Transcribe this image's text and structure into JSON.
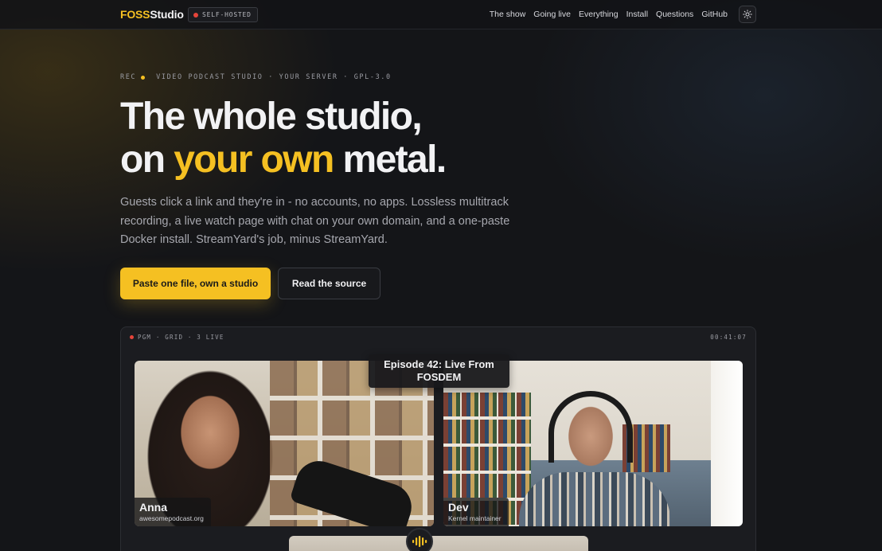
{
  "nav": {
    "logo_part1": "FOSS",
    "logo_part2": "Studio",
    "badge": "SELF-HOSTED",
    "links": [
      "The show",
      "Going live",
      "Everything",
      "Install",
      "Questions",
      "GitHub"
    ],
    "theme_icon": "sun-icon"
  },
  "hero": {
    "eyebrow_rec": "REC",
    "eyebrow_text": "VIDEO PODCAST STUDIO · YOUR SERVER · GPL-3.0",
    "headline_line1": "The whole studio,",
    "headline_line2_a": "on",
    "headline_line2_highlight": "your own",
    "headline_line2_b": "metal.",
    "lede": "Guests click a link and they're in - no accounts, no apps. Lossless multitrack recording, a live watch page with chat on your own domain, and a one-paste Docker install. StreamYard's job, minus StreamYard.",
    "primary_cta": "Paste one file, own a studio",
    "secondary_cta": "Read the source"
  },
  "studio": {
    "status": "PGM · GRID · 3 LIVE",
    "timer": "00:41:07",
    "episode_title": "Episode 42: Live From FOSDEM",
    "guests": [
      {
        "name": "Anna",
        "subtitle": "awesomepodcast.org"
      },
      {
        "name": "Dev",
        "subtitle": "Kernel maintainer"
      }
    ],
    "audio_icon": "audio-wave-icon"
  },
  "colors": {
    "accent": "#f5c022",
    "background": "#141518",
    "live_dot": "#e5443a"
  }
}
